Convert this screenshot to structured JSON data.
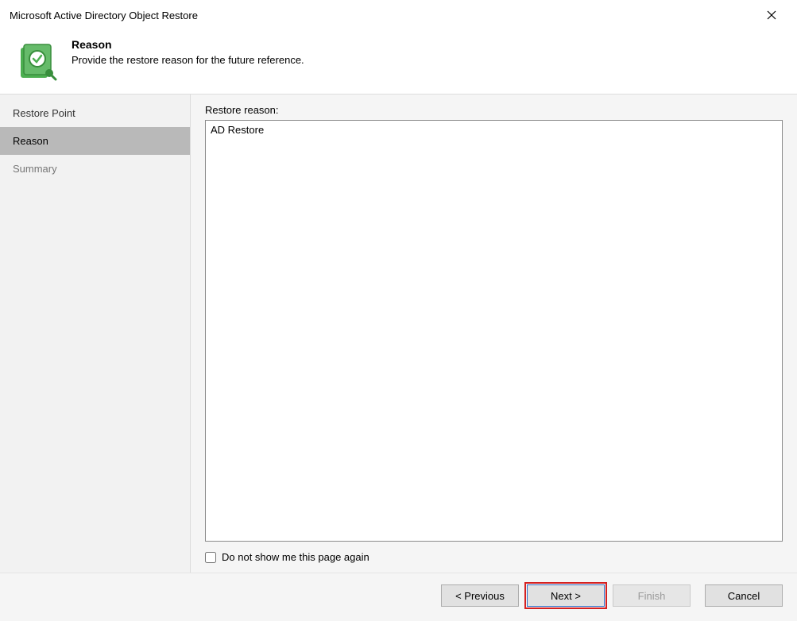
{
  "window": {
    "title": "Microsoft Active Directory Object Restore"
  },
  "header": {
    "heading": "Reason",
    "subtext": "Provide the restore reason for the future reference."
  },
  "sidebar": {
    "items": [
      {
        "label": "Restore Point"
      },
      {
        "label": "Reason"
      },
      {
        "label": "Summary"
      }
    ]
  },
  "main": {
    "field_label": "Restore reason:",
    "reason_value": "AD Restore",
    "checkbox_label": "Do not show me this page again"
  },
  "footer": {
    "previous": "< Previous",
    "next": "Next >",
    "finish": "Finish",
    "cancel": "Cancel"
  }
}
